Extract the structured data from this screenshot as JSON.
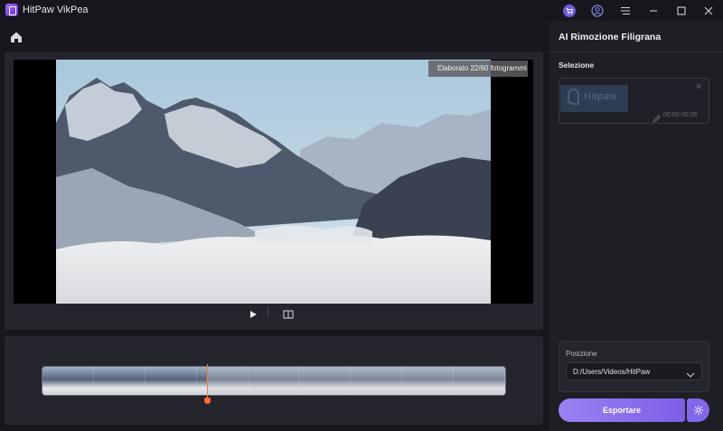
{
  "app": {
    "title": "HitPaw VikPea"
  },
  "titlebar_icons": [
    "cart-icon",
    "account-icon",
    "menu-icon",
    "minimize-icon",
    "maximize-icon",
    "close-icon"
  ],
  "preview": {
    "status": "Elaborato 22/60 fotogrammi",
    "progress": {
      "processed": 22,
      "total": 60
    }
  },
  "sidebar": {
    "title": "AI Rimozione Filigrana",
    "selection_label": "Selezione",
    "selection_item": {
      "watermark_text": "Hitpaw",
      "time_range": "00:00-00:05"
    },
    "position_label": "Posizione",
    "position_value": "D:/Users/Videos/HitPaw",
    "export_label": "Esportare"
  },
  "colors": {
    "accent": "#8b6ff0",
    "playhead": "#ff6a2a",
    "background": "#17171d",
    "panel": "#25252d"
  }
}
